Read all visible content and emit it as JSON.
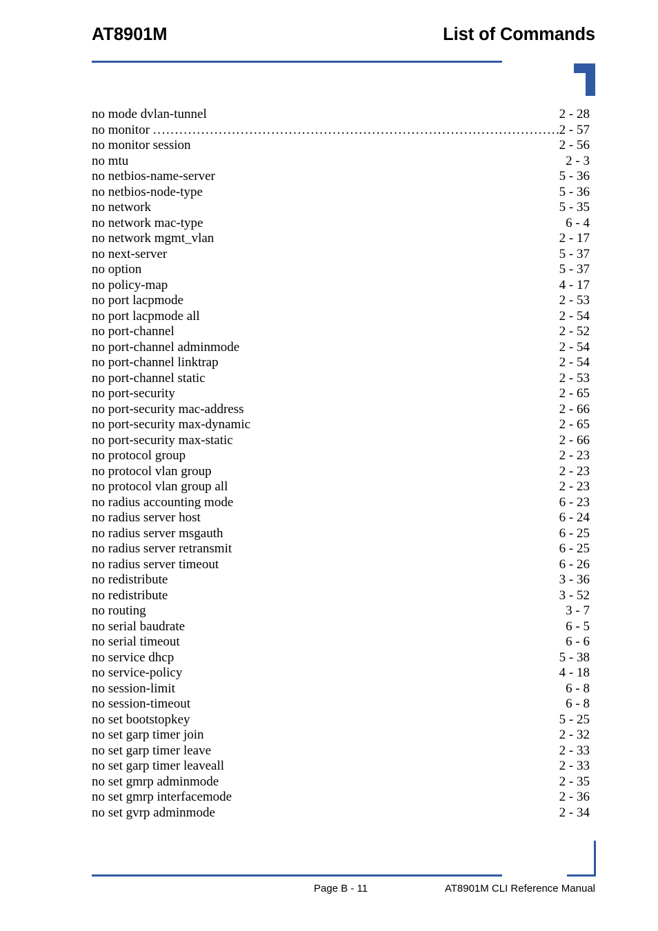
{
  "header": {
    "left_title": "AT8901M",
    "right_title": "List of Commands"
  },
  "footer": {
    "page_label": "Page B - 11",
    "manual_label": "AT8901M CLI Reference Manual"
  },
  "index": {
    "entries": [
      {
        "label": "no mode dvlan-tunnel",
        "page": "2 - 28",
        "leaders": false
      },
      {
        "label": "no monitor",
        "page": "2 - 57",
        "leaders": true
      },
      {
        "label": "no monitor session",
        "page": "2 - 56",
        "leaders": false
      },
      {
        "label": "no mtu",
        "page": "2 - 3",
        "leaders": false
      },
      {
        "label": "no netbios-name-server",
        "page": "5 - 36",
        "leaders": false
      },
      {
        "label": "no netbios-node-type",
        "page": "5 - 36",
        "leaders": false
      },
      {
        "label": "no network",
        "page": "5 - 35",
        "leaders": false
      },
      {
        "label": "no network mac-type",
        "page": "6 - 4",
        "leaders": false
      },
      {
        "label": "no network mgmt_vlan",
        "page": "2 - 17",
        "leaders": false
      },
      {
        "label": "no next-server",
        "page": "5 - 37",
        "leaders": false
      },
      {
        "label": "no option",
        "page": "5 - 37",
        "leaders": false
      },
      {
        "label": "no policy-map",
        "page": "4 - 17",
        "leaders": false
      },
      {
        "label": "no port lacpmode",
        "page": "2 - 53",
        "leaders": false
      },
      {
        "label": "no port lacpmode all",
        "page": "2 - 54",
        "leaders": false
      },
      {
        "label": "no port-channel",
        "page": "2 - 52",
        "leaders": false
      },
      {
        "label": "no port-channel adminmode",
        "page": "2 - 54",
        "leaders": false
      },
      {
        "label": "no port-channel linktrap",
        "page": "2 - 54",
        "leaders": false
      },
      {
        "label": "no port-channel static",
        "page": "2 - 53",
        "leaders": false
      },
      {
        "label": "no port-security",
        "page": "2 - 65",
        "leaders": false
      },
      {
        "label": "no port-security mac-address",
        "page": "2 - 66",
        "leaders": false
      },
      {
        "label": "no port-security max-dynamic",
        "page": "2 - 65",
        "leaders": false
      },
      {
        "label": "no port-security max-static",
        "page": "2 - 66",
        "leaders": false
      },
      {
        "label": "no protocol group",
        "page": "2 - 23",
        "leaders": false
      },
      {
        "label": "no protocol vlan group",
        "page": "2 - 23",
        "leaders": false
      },
      {
        "label": "no protocol vlan group all",
        "page": "2 - 23",
        "leaders": false
      },
      {
        "label": "no radius accounting mode",
        "page": "6 - 23",
        "leaders": false
      },
      {
        "label": "no radius server host",
        "page": "6 - 24",
        "leaders": false
      },
      {
        "label": "no radius server msgauth",
        "page": "6 - 25",
        "leaders": false
      },
      {
        "label": "no radius server retransmit",
        "page": "6 - 25",
        "leaders": false
      },
      {
        "label": "no radius server timeout",
        "page": "6 - 26",
        "leaders": false
      },
      {
        "label": "no redistribute",
        "page": "3 - 36",
        "leaders": false
      },
      {
        "label": "no redistribute",
        "page": "3 - 52",
        "leaders": false
      },
      {
        "label": "no routing",
        "page": "3 - 7",
        "leaders": false
      },
      {
        "label": "no serial baudrate",
        "page": "6 - 5",
        "leaders": false
      },
      {
        "label": "no serial timeout",
        "page": "6 - 6",
        "leaders": false
      },
      {
        "label": "no service dhcp",
        "page": "5 - 38",
        "leaders": false
      },
      {
        "label": "no service-policy",
        "page": "4 - 18",
        "leaders": false
      },
      {
        "label": "no session-limit",
        "page": "6 - 8",
        "leaders": false
      },
      {
        "label": "no session-timeout",
        "page": "6 - 8",
        "leaders": false
      },
      {
        "label": "no set bootstopkey",
        "page": "5 - 25",
        "leaders": false
      },
      {
        "label": "no set garp timer join",
        "page": "2 - 32",
        "leaders": false
      },
      {
        "label": "no set garp timer leave",
        "page": "2 - 33",
        "leaders": false
      },
      {
        "label": "no set garp timer leaveall",
        "page": "2 - 33",
        "leaders": false
      },
      {
        "label": "no set gmrp adminmode",
        "page": "2 - 35",
        "leaders": false
      },
      {
        "label": "no set gmrp interfacemode",
        "page": "2 - 36",
        "leaders": false
      },
      {
        "label": "no set gvrp adminmode",
        "page": "2 - 34",
        "leaders": false
      }
    ]
  },
  "theme": {
    "accent_blue": "#2f59a3",
    "text_black": "#000000",
    "page_background": "#ffffff"
  }
}
